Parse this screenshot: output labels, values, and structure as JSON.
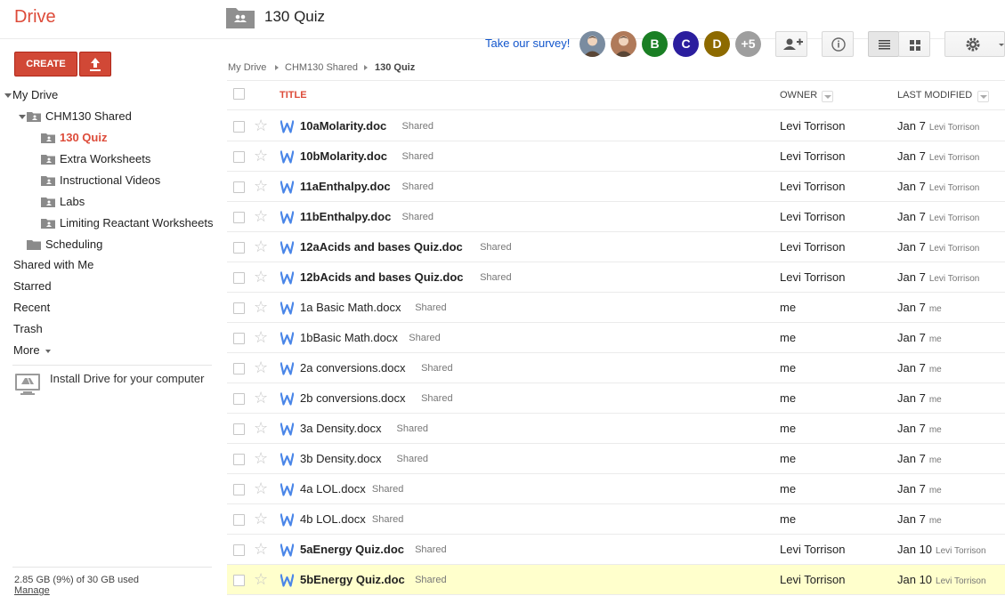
{
  "app": {
    "logo": "Drive"
  },
  "header": {
    "folder_title": "130 Quiz",
    "survey_link": "Take our survey!",
    "avatars": [
      {
        "letter": "",
        "kind": "photo",
        "color": "#7a8ca0"
      },
      {
        "letter": "",
        "kind": "photo",
        "color": "#b07a5a"
      },
      {
        "letter": "B",
        "kind": "letter",
        "color": "#1a7f24"
      },
      {
        "letter": "C",
        "kind": "letter",
        "color": "#2b1e9e"
      },
      {
        "letter": "D",
        "kind": "letter",
        "color": "#8d6a00"
      },
      {
        "letter": "+5",
        "kind": "letter",
        "color": "#9e9e9e"
      }
    ],
    "buttons": {
      "share_icon": "add-person-icon",
      "details_icon": "info-icon",
      "list_view_icon": "list-view-icon",
      "grid_view_icon": "grid-view-icon",
      "settings_icon": "gear-icon"
    }
  },
  "sidebar": {
    "create_label": "CREATE",
    "upload_icon": "upload-icon",
    "tree": {
      "my_drive": "My Drive",
      "chm130": "CHM130 Shared",
      "quiz": "130 Quiz",
      "extra": "Extra Worksheets",
      "videos": "Instructional Videos",
      "labs": "Labs",
      "limiting": "Limiting Reactant Worksheets",
      "scheduling": "Scheduling"
    },
    "links": {
      "shared": "Shared with Me",
      "starred": "Starred",
      "recent": "Recent",
      "trash": "Trash",
      "more": "More"
    },
    "install": "Install Drive for your computer",
    "storage": "2.85 GB (9%) of 30 GB used",
    "manage": "Manage"
  },
  "breadcrumb": {
    "root": "My Drive",
    "parent": "CHM130 Shared",
    "current": "130 Quiz"
  },
  "table": {
    "columns": {
      "title": "TITLE",
      "owner": "OWNER",
      "modified": "LAST MODIFIED"
    },
    "shared_label": "Shared",
    "rows": [
      {
        "name": "10aMolarity.doc",
        "bold": true,
        "owner": "Levi Torrison",
        "date": "Jan 7",
        "by": "Levi Torrison"
      },
      {
        "name": "10bMolarity.doc",
        "bold": true,
        "owner": "Levi Torrison",
        "date": "Jan 7",
        "by": "Levi Torrison"
      },
      {
        "name": "11aEnthalpy.doc",
        "bold": true,
        "owner": "Levi Torrison",
        "date": "Jan 7",
        "by": "Levi Torrison"
      },
      {
        "name": "11bEnthalpy.doc",
        "bold": true,
        "owner": "Levi Torrison",
        "date": "Jan 7",
        "by": "Levi Torrison"
      },
      {
        "name": "12aAcids and bases Quiz.doc",
        "bold": true,
        "owner": "Levi Torrison",
        "date": "Jan 7",
        "by": "Levi Torrison"
      },
      {
        "name": "12bAcids and bases Quiz.doc",
        "bold": true,
        "owner": "Levi Torrison",
        "date": "Jan 7",
        "by": "Levi Torrison"
      },
      {
        "name": "1a Basic Math.docx",
        "bold": false,
        "owner": "me",
        "date": "Jan 7",
        "by": "me"
      },
      {
        "name": "1bBasic Math.docx",
        "bold": false,
        "owner": "me",
        "date": "Jan 7",
        "by": "me"
      },
      {
        "name": "2a conversions.docx",
        "bold": false,
        "owner": "me",
        "date": "Jan 7",
        "by": "me"
      },
      {
        "name": "2b conversions.docx",
        "bold": false,
        "owner": "me",
        "date": "Jan 7",
        "by": "me"
      },
      {
        "name": "3a Density.docx",
        "bold": false,
        "owner": "me",
        "date": "Jan 7",
        "by": "me"
      },
      {
        "name": "3b Density.docx",
        "bold": false,
        "owner": "me",
        "date": "Jan 7",
        "by": "me"
      },
      {
        "name": "4a LOL.docx",
        "bold": false,
        "owner": "me",
        "date": "Jan 7",
        "by": "me"
      },
      {
        "name": "4b LOL.docx",
        "bold": false,
        "owner": "me",
        "date": "Jan 7",
        "by": "me"
      },
      {
        "name": "5aEnergy Quiz.doc",
        "bold": true,
        "owner": "Levi Torrison",
        "date": "Jan 10",
        "by": "Levi Torrison"
      },
      {
        "name": "5bEnergy Quiz.doc",
        "bold": true,
        "owner": "Levi Torrison",
        "date": "Jan 10",
        "by": "Levi Torrison",
        "highlight": true
      }
    ]
  },
  "colors": {
    "brand_red": "#dd4b39",
    "button_red": "#d14836",
    "doc_blue": "#4a86e8",
    "highlight": "#ffffcc",
    "link_blue": "#1155cc"
  }
}
